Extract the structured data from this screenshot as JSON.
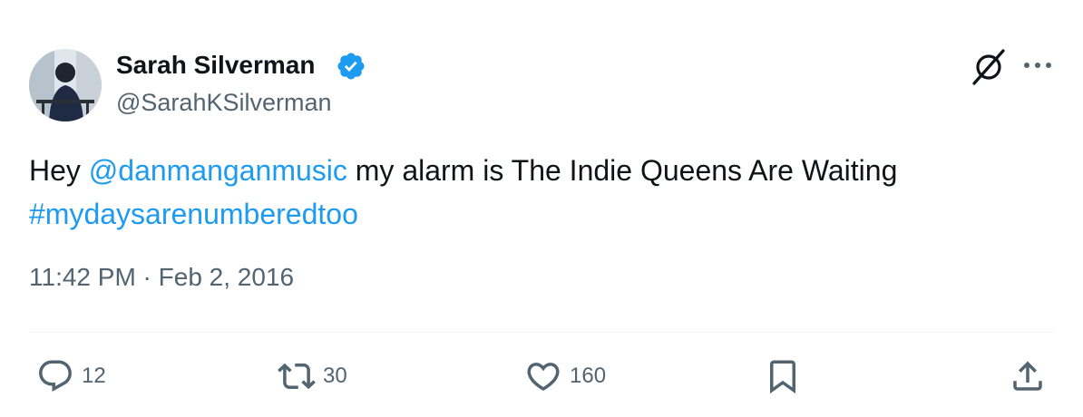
{
  "author": {
    "name": "Sarah Silverman",
    "handle": "@SarahKSilverman",
    "verified": true
  },
  "tweet": {
    "text_prefix": "Hey ",
    "mention": "@danmanganmusic",
    "text_middle": " my alarm is The Indie Queens Are Waiting ",
    "hashtag": "#mydaysarenumberedtoo"
  },
  "timestamp": "11:42 PM · Feb 2, 2016",
  "actions": {
    "reply_count": "12",
    "retweet_count": "30",
    "like_count": "160"
  },
  "colors": {
    "link": "#1d9bf0",
    "text": "#0f1419",
    "secondary": "#536471",
    "divider": "#eff3f4"
  },
  "icons": [
    "x-logo-icon",
    "more-icon",
    "verified-badge-icon",
    "reply-icon",
    "retweet-icon",
    "like-icon",
    "bookmark-icon",
    "share-icon"
  ]
}
